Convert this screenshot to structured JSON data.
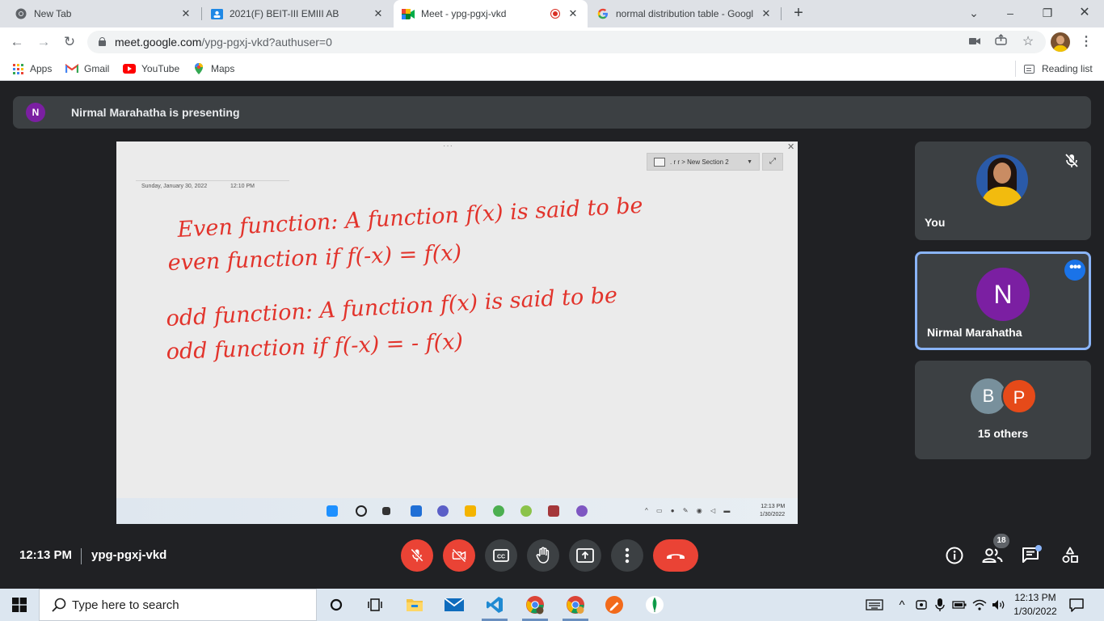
{
  "browser": {
    "tabs": [
      {
        "title": "New Tab",
        "icon": "chrome-icon",
        "active": false
      },
      {
        "title": "2021(F) BEIT-III EMIII AB",
        "icon": "classroom-icon",
        "active": false
      },
      {
        "title": "Meet - ypg-pgxj-vkd",
        "icon": "meet-icon",
        "active": true,
        "recording": true
      },
      {
        "title": "normal distribution table - Googl",
        "icon": "google-icon",
        "active": false
      }
    ],
    "new_tab": "+",
    "url_host": "meet.google.com",
    "url_path": "/ypg-pgxj-vkd?authuser=0",
    "bookmarks": [
      {
        "label": "Apps",
        "icon": "apps-grid-icon"
      },
      {
        "label": "Gmail",
        "icon": "gmail-icon"
      },
      {
        "label": "YouTube",
        "icon": "youtube-icon"
      },
      {
        "label": "Maps",
        "icon": "maps-icon"
      }
    ],
    "reading_list": "Reading list"
  },
  "meet": {
    "presenter_initial": "N",
    "presenting_text": "Nirmal Marahatha is presenting",
    "time": "12:13 PM",
    "meeting_code": "ypg-pgxj-vkd",
    "participants": [
      {
        "name": "You",
        "muted": true
      },
      {
        "name": "Nirmal Marahatha",
        "initial": "N",
        "active_speaker": true
      },
      {
        "name": "15 others",
        "initials": [
          "B",
          "P"
        ]
      }
    ],
    "participant_count": "18",
    "colors": {
      "bg": "#202124",
      "tile": "#3c4043",
      "danger": "#ea4335",
      "accent": "#8ab4f8",
      "avatar_purple": "#7b1fa2"
    }
  },
  "presentation": {
    "section_path": ". r r > New Section 2",
    "note_date": "Sunday, January 30, 2022",
    "note_time": "12:10 PM",
    "handwriting": [
      "Even function: A function f(x) is said to be",
      "even function if f(-x) = f(x)",
      "odd function: A function f(x) is said to be",
      "odd function if f(-x) = - f(x)"
    ],
    "inner_clock_time": "12:13 PM",
    "inner_clock_date": "1/30/2022"
  },
  "taskbar": {
    "search_placeholder": "Type here to search",
    "clock_time": "12:13 PM",
    "clock_date": "1/30/2022",
    "apps": [
      "cortana-icon",
      "task-view-icon",
      "file-explorer-icon",
      "mail-icon",
      "vscode-icon",
      "chrome-icon",
      "chrome-profile-icon",
      "drawing-app-icon",
      "mongodb-icon"
    ]
  }
}
